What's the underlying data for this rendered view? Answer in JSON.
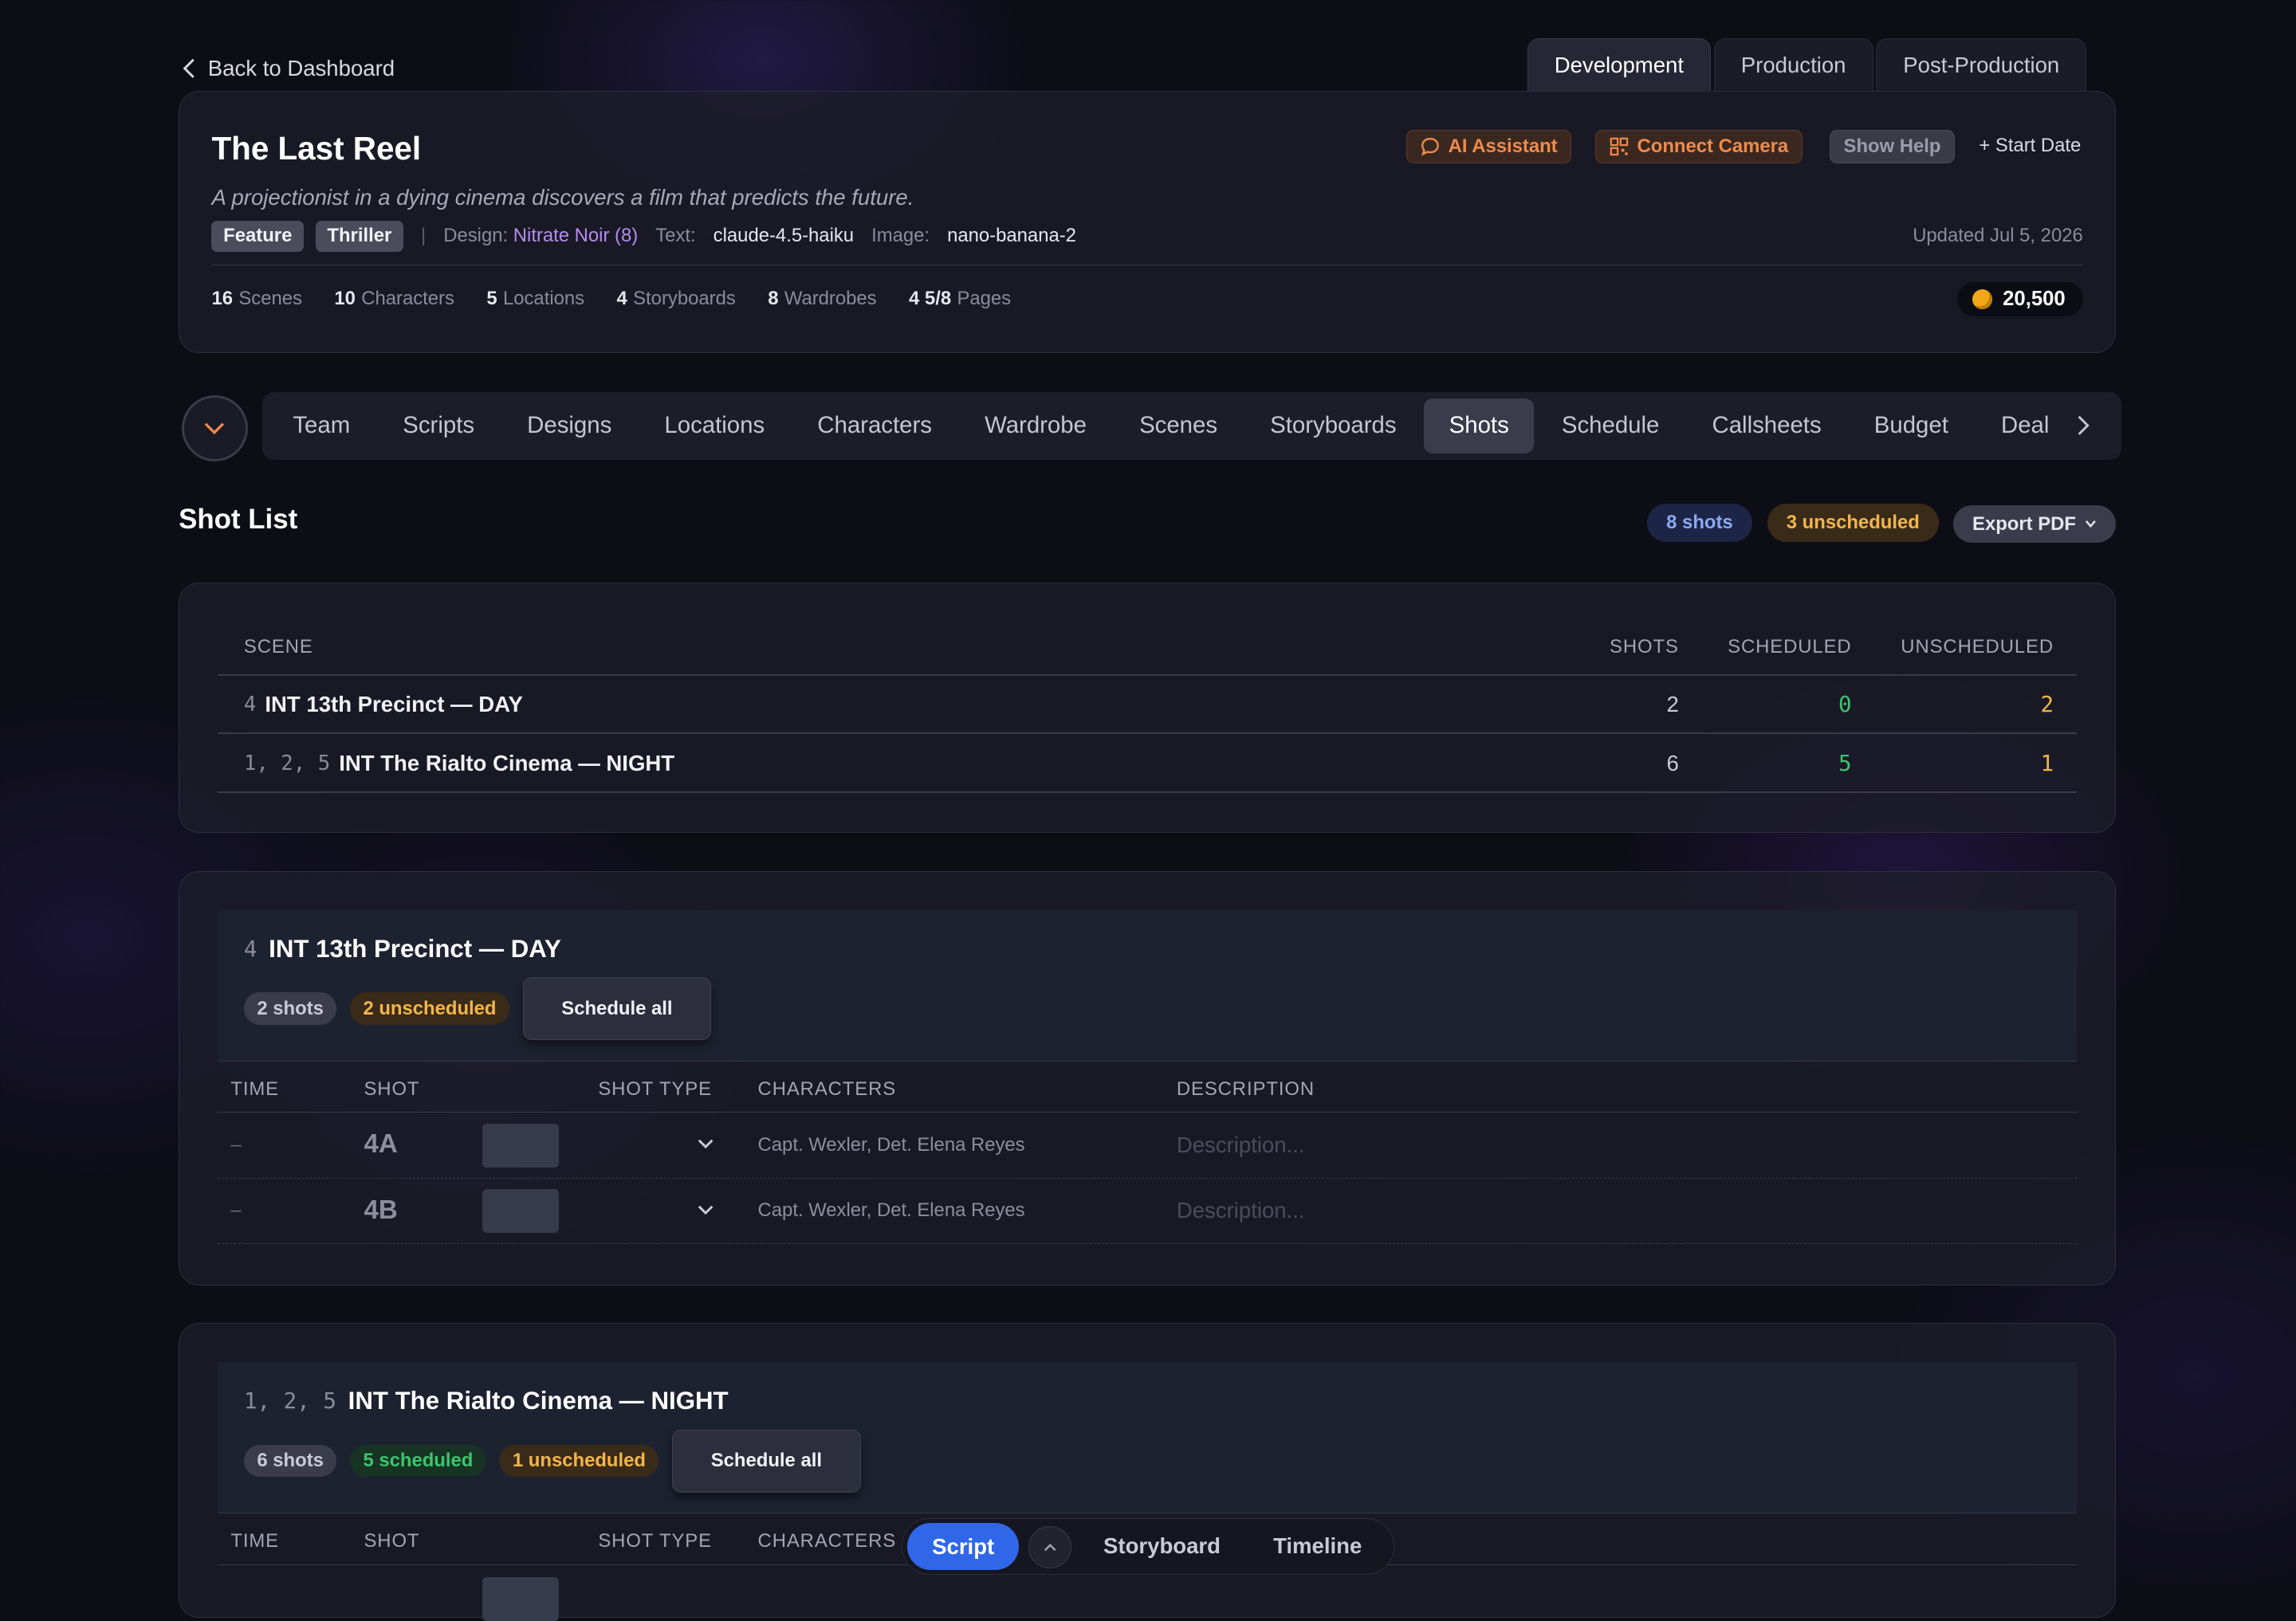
{
  "nav_back": "Back to Dashboard",
  "phase_tabs": [
    "Development",
    "Production",
    "Post-Production"
  ],
  "project": {
    "title": "The Last Reel",
    "logline": "A projectionist in a dying cinema discovers a film that predicts the future.",
    "tags": [
      "Feature",
      "Thriller"
    ],
    "design_label": "Design:",
    "design_value": "Nitrate Noir (8)",
    "text_label": "Text:",
    "text_value": "claude-4.5-haiku",
    "image_label": "Image:",
    "image_value": "nano-banana-2",
    "updated": "Updated Jul 5, 2026",
    "coins": "20,500"
  },
  "header_buttons": {
    "ai": "AI Assistant",
    "camera": "Connect Camera",
    "help": "Show Help",
    "start_date": "+ Start Date"
  },
  "stats": [
    {
      "num": "16",
      "label": "Scenes"
    },
    {
      "num": "10",
      "label": "Characters"
    },
    {
      "num": "5",
      "label": "Locations"
    },
    {
      "num": "4",
      "label": "Storyboards"
    },
    {
      "num": "8",
      "label": "Wardrobes"
    },
    {
      "num": "4 5/8",
      "label": "Pages"
    }
  ],
  "nav_tabs": [
    "Team",
    "Scripts",
    "Designs",
    "Locations",
    "Characters",
    "Wardrobe",
    "Scenes",
    "Storyboards",
    "Shots",
    "Schedule",
    "Callsheets",
    "Budget",
    "Deal"
  ],
  "shot_list": {
    "title": "Shot List",
    "shots_pill": "8 shots",
    "unscheduled_pill": "3 unscheduled",
    "export": "Export PDF"
  },
  "summary": {
    "headers": [
      "SCENE",
      "SHOTS",
      "SCHEDULED",
      "UNSCHEDULED"
    ],
    "rows": [
      {
        "num": "4",
        "name": "INT 13th Precinct — DAY",
        "shots": "2",
        "scheduled": "0",
        "unscheduled": "2"
      },
      {
        "num": "1, 2, 5",
        "name": "INT The Rialto Cinema — NIGHT",
        "shots": "6",
        "scheduled": "5",
        "unscheduled": "1"
      }
    ]
  },
  "table_headers": [
    "TIME",
    "SHOT",
    "SHOT TYPE",
    "CHARACTERS",
    "DESCRIPTION"
  ],
  "scene1": {
    "num": "4",
    "title": "INT 13th Precinct — DAY",
    "shots": "2 shots",
    "unscheduled": "2 unscheduled",
    "schedule_all": "Schedule all",
    "rows": [
      {
        "time": "–",
        "shot": "4A",
        "characters": "Capt. Wexler, Det. Elena Reyes",
        "description_placeholder": "Description..."
      },
      {
        "time": "–",
        "shot": "4B",
        "characters": "Capt. Wexler, Det. Elena Reyes",
        "description_placeholder": "Description..."
      }
    ]
  },
  "scene2": {
    "num": "1, 2, 5",
    "title": "INT The Rialto Cinema — NIGHT",
    "shots": "6 shots",
    "scheduled": "5 scheduled",
    "unscheduled": "1 unscheduled",
    "schedule_all": "Schedule all"
  },
  "bottom_bar": {
    "script": "Script",
    "storyboard": "Storyboard",
    "timeline": "Timeline"
  },
  "colors": {
    "accent_orange": "#f08a4b",
    "scheduled_green": "#3ec46d",
    "unscheduled_amber": "#f1b64a",
    "active_blue": "#2f67e8",
    "design_purple": "#b68cf0"
  }
}
